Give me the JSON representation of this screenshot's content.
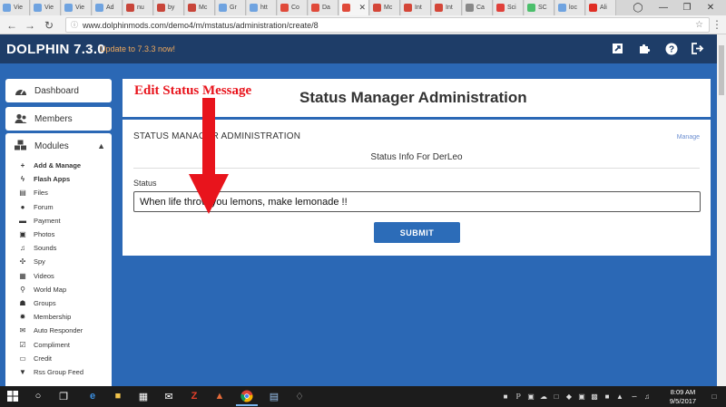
{
  "browser": {
    "tabs": [
      {
        "label": "Vie",
        "color": "#6fa3e0"
      },
      {
        "label": "Vie",
        "color": "#6fa3e0"
      },
      {
        "label": "Vie",
        "color": "#6fa3e0"
      },
      {
        "label": "Ad",
        "color": "#6fa3e0"
      },
      {
        "label": "nu",
        "color": "#c8453a"
      },
      {
        "label": "by",
        "color": "#c8453a"
      },
      {
        "label": "Mc",
        "color": "#c8453a"
      },
      {
        "label": "Gr",
        "color": "#6fa3e0"
      },
      {
        "label": "htt",
        "color": "#6fa3e0"
      },
      {
        "label": "Co",
        "color": "#e04a3a"
      },
      {
        "label": "Da",
        "color": "#e04a3a"
      },
      {
        "label": "",
        "color": "#e04a3a"
      },
      {
        "label": "Mc",
        "color": "#d44638"
      },
      {
        "label": "Int",
        "color": "#d44638"
      },
      {
        "label": "Int",
        "color": "#d44638"
      },
      {
        "label": "Ca",
        "color": "#888888"
      },
      {
        "label": "Sci",
        "color": "#e0403a"
      },
      {
        "label": "SC",
        "color": "#4bbf6b"
      },
      {
        "label": "loc",
        "color": "#6fa3e0"
      },
      {
        "label": "Ali",
        "color": "#e02e24"
      }
    ],
    "active_tab_index": 11,
    "url": "www.dolphinmods.com/demo4/m/mstatus/administration/create/8"
  },
  "app": {
    "brand": "DOLPHIN 7.3.0",
    "update": "Update to 7.3.3 now!",
    "header_icons": [
      "edit-icon",
      "puzzle-icon",
      "help-icon",
      "logout-icon"
    ]
  },
  "sidebar": {
    "dashboard": "Dashboard",
    "members": "Members",
    "modules": "Modules",
    "items": [
      {
        "label": "Add & Manage",
        "icon": "+",
        "bold": true
      },
      {
        "label": "Flash Apps",
        "icon": "ϟ",
        "bold": true
      },
      {
        "label": "Files",
        "icon": "▤",
        "bold": false
      },
      {
        "label": "Forum",
        "icon": "●",
        "bold": false
      },
      {
        "label": "Payment",
        "icon": "▬",
        "bold": false
      },
      {
        "label": "Photos",
        "icon": "▣",
        "bold": false
      },
      {
        "label": "Sounds",
        "icon": "♫",
        "bold": false
      },
      {
        "label": "Spy",
        "icon": "✣",
        "bold": false
      },
      {
        "label": "Videos",
        "icon": "▦",
        "bold": false
      },
      {
        "label": "World Map",
        "icon": "⚲",
        "bold": false
      },
      {
        "label": "Groups",
        "icon": "☗",
        "bold": false
      },
      {
        "label": "Membership",
        "icon": "✹",
        "bold": false
      },
      {
        "label": "Auto Responder",
        "icon": "✉",
        "bold": false
      },
      {
        "label": "Compliment",
        "icon": "☑",
        "bold": false
      },
      {
        "label": "Credit",
        "icon": "▭",
        "bold": false
      },
      {
        "label": "Rss Group Feed",
        "icon": "▼",
        "bold": false
      }
    ]
  },
  "main": {
    "title": "Status Manager Administration",
    "admin_label": "STATUS MANAGER ADMINISTRATION",
    "manage": "Manage",
    "info_title": "Status Info For DerLeo",
    "status_label": "Status",
    "status_value": "When life throw you lemons, make lemonade !!",
    "submit": "SUBMIT"
  },
  "annotation": {
    "text": "Edit Status Message",
    "color": "#e8141c"
  },
  "taskbar": {
    "time": "8:09 AM",
    "date": "9/5/2017"
  }
}
